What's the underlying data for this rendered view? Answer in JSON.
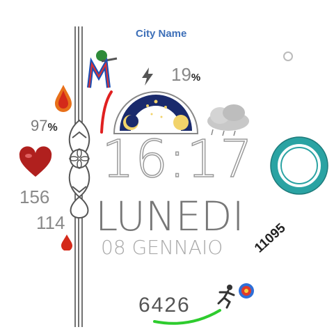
{
  "city_name": "City Name",
  "battery": {
    "value": "19",
    "unit": "%"
  },
  "humidity": {
    "value": "97",
    "unit": "%"
  },
  "time": "16:17",
  "weekday": "LUNEDI",
  "date": "08 GENNAIO",
  "heart_rate": {
    "current": "156",
    "secondary": "114"
  },
  "steps": {
    "count": "6426",
    "goal": "11095",
    "progress": 0.58
  },
  "ring_progress": 0.85,
  "colors": {
    "city": "#3d6fb8",
    "steps_arc": "#2ecc2e",
    "battery_arc": "#e02020",
    "ring": "#2aa3a3"
  },
  "icons": [
    "app-logo-icon",
    "lightning-icon",
    "raindrop-icon",
    "heart-icon",
    "small-drop-icon",
    "moon-phase-icon",
    "cloud-icon",
    "runner-icon",
    "target-icon",
    "ornament-icon"
  ]
}
